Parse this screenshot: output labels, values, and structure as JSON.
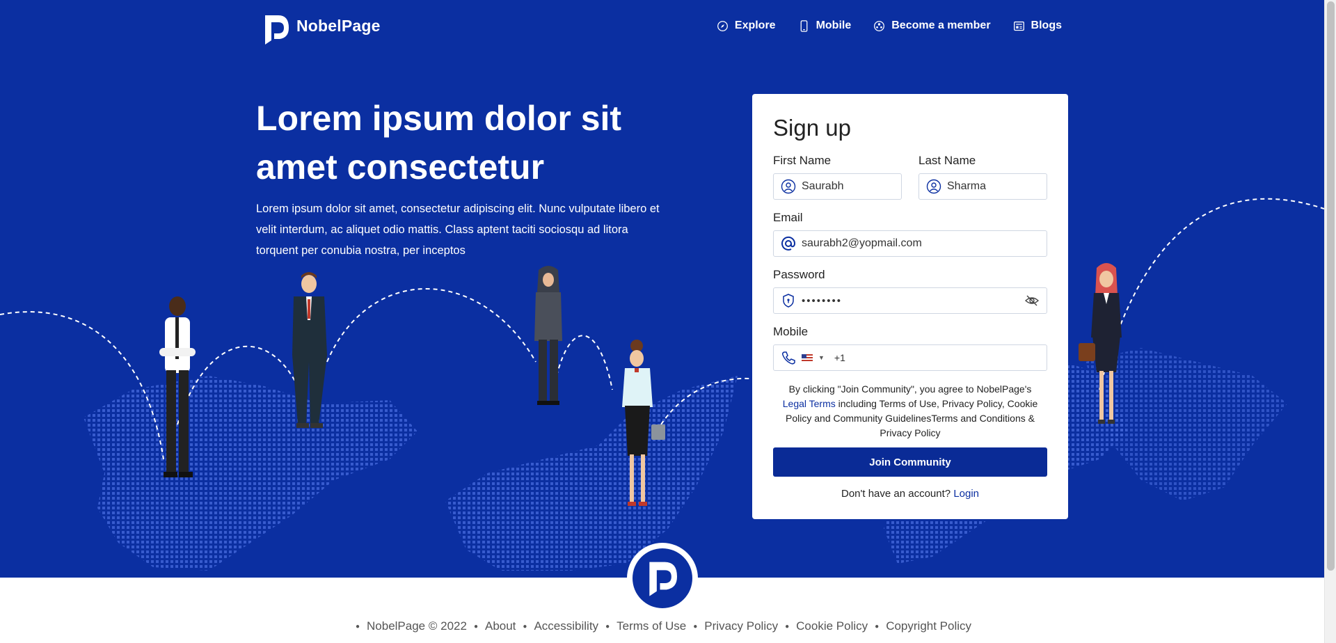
{
  "brand": {
    "name": "NobelPage"
  },
  "nav": {
    "items": [
      {
        "label": "Explore",
        "icon": "compass-icon"
      },
      {
        "label": "Mobile",
        "icon": "phone-icon"
      },
      {
        "label": "Become a member",
        "icon": "members-icon"
      },
      {
        "label": "Blogs",
        "icon": "blog-icon"
      }
    ]
  },
  "hero": {
    "title": "Lorem ipsum dolor sit amet consectetur",
    "text": "Lorem ipsum dolor sit amet, consectetur adipiscing elit. Nunc vulputate libero et velit interdum, ac aliquet odio mattis. Class aptent taciti sociosqu ad litora torquent per conubia nostra, per inceptos"
  },
  "signup": {
    "title": "Sign up",
    "first_name": {
      "label": "First Name",
      "value": "Saurabh"
    },
    "last_name": {
      "label": "Last Name",
      "value": "Sharma"
    },
    "email": {
      "label": "Email",
      "value": "saurabh2@yopmail.com"
    },
    "password": {
      "label": "Password",
      "value": "••••••••"
    },
    "mobile": {
      "label": "Mobile",
      "country_code": "+1"
    },
    "terms_pre": "By clicking \"Join Community\", you agree to NobelPage's",
    "terms_link": "Legal Terms",
    "terms_post": "including Terms of Use, Privacy Policy, Cookie Policy and Community GuidelinesTerms and Conditions & Privacy Policy",
    "join_label": "Join Community",
    "login_prompt": "Don't have an account?",
    "login_link": "Login"
  },
  "footer": {
    "links": [
      "NobelPage © 2022",
      "About",
      "Accessibility",
      "Terms of Use",
      "Privacy Policy",
      "Cookie Policy",
      "Copyright Policy"
    ]
  },
  "colors": {
    "primary": "#0b2fa1",
    "button": "#0a2b96",
    "white": "#ffffff"
  }
}
